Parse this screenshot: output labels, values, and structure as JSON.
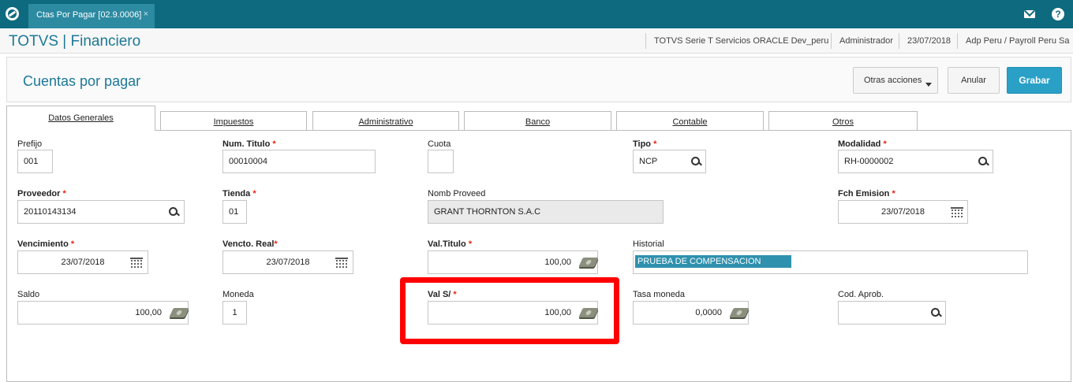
{
  "window": {
    "tab_title": "Ctas Por Pagar [02.9.0006]",
    "tab_close": "×"
  },
  "header": {
    "brand": "TOTVS | Financiero",
    "environment": "TOTVS Serie T Servicios ORACLE Dev_peru",
    "user": "Administrador",
    "date": "23/07/2018",
    "company": "Adp Peru / Payroll Peru Sa"
  },
  "page": {
    "title": "Cuentas por pagar",
    "actions": {
      "more": "Otras acciones",
      "cancel": "Anular",
      "save": "Grabar"
    }
  },
  "tabs": [
    "Datos Generales",
    "Impuestos",
    "Administrativo",
    "Banco",
    "Contable",
    "Otros"
  ],
  "active_tab": "Datos Generales",
  "form": {
    "prefijo": {
      "label": "Prefijo",
      "value": "001"
    },
    "num_titulo": {
      "label": "Num. Titulo",
      "required": "*",
      "value": "00010004"
    },
    "cuota": {
      "label": "Cuota",
      "value": ""
    },
    "tipo": {
      "label": "Tipo",
      "required": "*",
      "value": "NCP"
    },
    "modalidad": {
      "label": "Modalidad",
      "required": "*",
      "value": "RH-0000002"
    },
    "proveedor": {
      "label": "Proveedor",
      "required": "*",
      "value": "20110143134"
    },
    "tienda": {
      "label": "Tienda",
      "required": "*",
      "value": "01"
    },
    "nomb_proveed": {
      "label": "Nomb Proveed",
      "value": "GRANT THORNTON S.A.C"
    },
    "fch_emision": {
      "label": "Fch Emision",
      "required": "*",
      "value": "23/07/2018"
    },
    "vencimiento": {
      "label": "Vencimiento",
      "required": "*",
      "value": "23/07/2018"
    },
    "vencto_real": {
      "label": "Vencto. Real",
      "required": "*",
      "value": "23/07/2018"
    },
    "val_titulo": {
      "label": "Val.Titulo",
      "required": "*",
      "value": "100,00"
    },
    "historial": {
      "label": "Historial",
      "value": "PRUEBA DE COMPENSACION"
    },
    "saldo": {
      "label": "Saldo",
      "value": "100,00"
    },
    "moneda": {
      "label": "Moneda",
      "value": "1"
    },
    "val_s": {
      "label": "Val S/",
      "required": "*",
      "value": "100,00"
    },
    "tasa_moneda": {
      "label": "Tasa moneda",
      "value": "0,0000"
    },
    "cod_aprob": {
      "label": "Cod. Aprob.",
      "value": ""
    }
  },
  "colors": {
    "topbar": "#0d6a7f",
    "accent": "#1c7896",
    "primary_button": "#2aa0c7",
    "highlight": "#ff0000"
  }
}
